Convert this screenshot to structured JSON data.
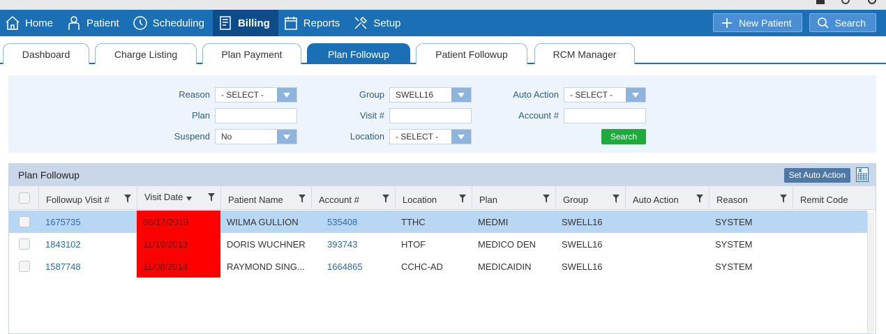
{
  "nav": {
    "items": [
      {
        "label": "Home",
        "icon": "home-icon"
      },
      {
        "label": "Patient",
        "icon": "person-icon"
      },
      {
        "label": "Scheduling",
        "icon": "clock-icon"
      },
      {
        "label": "Billing",
        "icon": "billing-icon",
        "active": true
      },
      {
        "label": "Reports",
        "icon": "calendar-icon"
      },
      {
        "label": "Setup",
        "icon": "tools-icon"
      }
    ],
    "new_patient": "New Patient",
    "search": "Search"
  },
  "tabs": [
    "Dashboard",
    "Charge Listing",
    "Plan Payment",
    "Plan Followup",
    "Patient Followup",
    "RCM Manager"
  ],
  "active_tab": "Plan Followup",
  "filters": {
    "reason_label": "Reason",
    "reason_value": "- SELECT -",
    "plan_label": "Plan",
    "plan_value": "",
    "suspend_label": "Suspend",
    "suspend_value": "No",
    "group_label": "Group",
    "group_value": "SWELL16",
    "visit_label": "Visit #",
    "visit_value": "",
    "location_label": "Location",
    "location_value": "- SELECT -",
    "autoaction_label": "Auto Action",
    "autoaction_value": "- SELECT -",
    "account_label": "Account #",
    "account_value": "",
    "search_button": "Search"
  },
  "grid": {
    "title": "Plan Followup",
    "set_auto_action": "Set Auto Action",
    "columns": [
      "Followup Visit #",
      "Visit Date",
      "Patient Name",
      "Account #",
      "Location",
      "Plan",
      "Group",
      "Auto Action",
      "Reason",
      "Remit Code"
    ],
    "rows": [
      {
        "visit": "1675735",
        "date": "06/17/2019",
        "name": "WILMA GULLION",
        "account": "535408",
        "location": "TTHC",
        "plan": "MEDMI",
        "group": "SWELL16",
        "auto": "",
        "reason": "SYSTEM",
        "remit": ""
      },
      {
        "visit": "1843102",
        "date": "11/19/2018",
        "name": "DORIS WUCHNER",
        "account": "393743",
        "location": "HTOF",
        "plan": "MEDICO DEN",
        "group": "SWELL16",
        "auto": "",
        "reason": "SYSTEM",
        "remit": ""
      },
      {
        "visit": "1587748",
        "date": "11/08/2018",
        "name": "RAYMOND SING...",
        "account": "1664865",
        "location": "CCHC-AD",
        "plan": "MEDICAIDIN",
        "group": "SWELL16",
        "auto": "",
        "reason": "SYSTEM",
        "remit": ""
      }
    ]
  },
  "colors": {
    "nav_bg": "#1a6fb5",
    "nav_active": "#0d4c88",
    "overdue_red": "#ff0000",
    "search_green": "#1eaa3c"
  }
}
